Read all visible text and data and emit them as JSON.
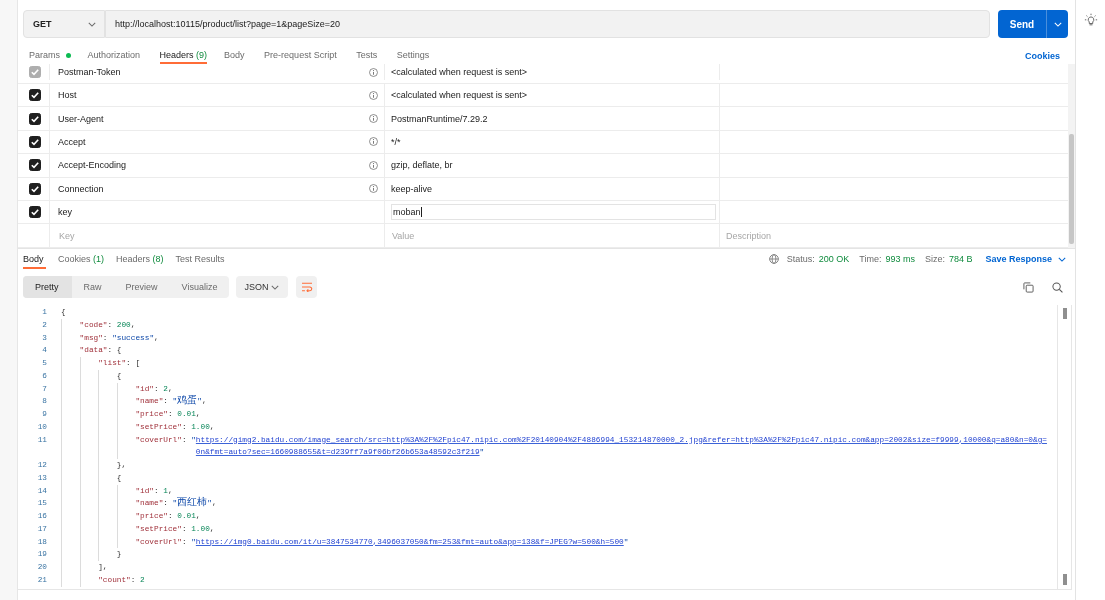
{
  "request": {
    "method": "GET",
    "url": "http://localhost:10115/product/list?page=1&pageSize=20",
    "send_label": "Send"
  },
  "request_tabs": [
    {
      "label": "Params",
      "indicator": true,
      "selected": false
    },
    {
      "label": "Authorization",
      "indicator": false,
      "selected": false
    },
    {
      "label": "Headers",
      "count": "(9)",
      "indicator": false,
      "selected": true
    },
    {
      "label": "Body",
      "indicator": false,
      "selected": false
    },
    {
      "label": "Pre-request Script",
      "indicator": false,
      "selected": false
    },
    {
      "label": "Tests",
      "indicator": false,
      "selected": false
    },
    {
      "label": "Settings",
      "indicator": false,
      "selected": false
    }
  ],
  "cookies_link": "Cookies",
  "headers_table": {
    "rows": [
      {
        "key": "Postman-Token",
        "value": "<calculated when request is sent>",
        "checked": true,
        "disabled": true,
        "auto": true,
        "editing": false
      },
      {
        "key": "Host",
        "value": "<calculated when request is sent>",
        "checked": true,
        "disabled": false,
        "auto": true,
        "editing": false
      },
      {
        "key": "User-Agent",
        "value": "PostmanRuntime/7.29.2",
        "checked": true,
        "disabled": false,
        "auto": true,
        "editing": false
      },
      {
        "key": "Accept",
        "value": "*/*",
        "checked": true,
        "disabled": false,
        "auto": true,
        "editing": false
      },
      {
        "key": "Accept-Encoding",
        "value": "gzip, deflate, br",
        "checked": true,
        "disabled": false,
        "auto": true,
        "editing": false
      },
      {
        "key": "Connection",
        "value": "keep-alive",
        "checked": true,
        "disabled": false,
        "auto": true,
        "editing": false
      },
      {
        "key": "key",
        "value": "moban",
        "checked": true,
        "disabled": false,
        "auto": false,
        "editing": true
      }
    ],
    "new_row": {
      "key": {
        "placeholder": "Key"
      },
      "value": {
        "placeholder": "Value"
      },
      "description": {
        "placeholder": "Description"
      }
    }
  },
  "response_tabs": [
    {
      "label": "Body",
      "selected": true
    },
    {
      "label": "Cookies",
      "count": "(1)",
      "selected": false
    },
    {
      "label": "Headers",
      "count": "(8)",
      "selected": false
    },
    {
      "label": "Test Results",
      "selected": false
    }
  ],
  "response_meta": {
    "status_label": "Status:",
    "status": "200 OK",
    "time_label": "Time:",
    "time": "993 ms",
    "size_label": "Size:",
    "size": "784 B",
    "save_label": "Save Response"
  },
  "view_modes": [
    {
      "label": "Pretty",
      "selected": true
    },
    {
      "label": "Raw",
      "selected": false
    },
    {
      "label": "Preview",
      "selected": false
    },
    {
      "label": "Visualize",
      "selected": false
    }
  ],
  "format": "JSON",
  "word_wrap": true,
  "code_lines": [
    {
      "number": "1",
      "tokens": [
        {
          "kind": "punct",
          "text": "{"
        }
      ],
      "children": [
        {
          "number": "2",
          "tokens": [
            {
              "kind": "key",
              "text": "\"code\""
            },
            {
              "kind": "punct",
              "text": ": "
            },
            {
              "kind": "number",
              "text": "200"
            },
            {
              "kind": "punct",
              "text": ","
            }
          ]
        },
        {
          "number": "3",
          "tokens": [
            {
              "kind": "key",
              "text": "\"msg\""
            },
            {
              "kind": "punct",
              "text": ": "
            },
            {
              "kind": "string",
              "text": "\"success\""
            },
            {
              "kind": "punct",
              "text": ","
            }
          ]
        },
        {
          "number": "4",
          "tokens": [
            {
              "kind": "key",
              "text": "\"data\""
            },
            {
              "kind": "punct",
              "text": ": {"
            }
          ],
          "children": [
            {
              "number": "5",
              "tokens": [
                {
                  "kind": "key",
                  "text": "\"list\""
                },
                {
                  "kind": "punct",
                  "text": ": ["
                }
              ],
              "children": [
                {
                  "number": "6",
                  "tokens": [
                    {
                      "kind": "punct",
                      "text": "{"
                    }
                  ],
                  "children": [
                    {
                      "number": "7",
                      "tokens": [
                        {
                          "kind": "key",
                          "text": "\"id\""
                        },
                        {
                          "kind": "punct",
                          "text": ": "
                        },
                        {
                          "kind": "number",
                          "text": "2"
                        },
                        {
                          "kind": "punct",
                          "text": ","
                        }
                      ]
                    },
                    {
                      "number": "8",
                      "tokens": [
                        {
                          "kind": "key",
                          "text": "\"name\""
                        },
                        {
                          "kind": "punct",
                          "text": ": "
                        },
                        {
                          "kind": "string",
                          "text": "\"鸡蛋\""
                        },
                        {
                          "kind": "punct",
                          "text": ","
                        }
                      ]
                    },
                    {
                      "number": "9",
                      "tokens": [
                        {
                          "kind": "key",
                          "text": "\"price\""
                        },
                        {
                          "kind": "punct",
                          "text": ": "
                        },
                        {
                          "kind": "number",
                          "text": "0.01"
                        },
                        {
                          "kind": "punct",
                          "text": ","
                        }
                      ]
                    },
                    {
                      "number": "10",
                      "tokens": [
                        {
                          "kind": "key",
                          "text": "\"setPrice\""
                        },
                        {
                          "kind": "punct",
                          "text": ": "
                        },
                        {
                          "kind": "number",
                          "text": "1.00"
                        },
                        {
                          "kind": "punct",
                          "text": ","
                        }
                      ]
                    },
                    {
                      "number": "11",
                      "tokens": [
                        {
                          "kind": "key",
                          "text": "\"coverUrl\""
                        },
                        {
                          "kind": "punct",
                          "text": ": "
                        },
                        {
                          "kind": "string",
                          "text": "\""
                        },
                        {
                          "kind": "link",
                          "text": "https://gimg2.baidu.com/image_search/src=http%3A%2F%2Fpic47.nipic.com%2F20140904%2F4886994_153214870000_2.jpg&refer=http%3A%2F%2Fpic47.nipic.com&app=2002&size=f9999,10000&q=a80&n=0&g=0n&fmt=auto?sec=1660988655&t=d239ff7a9f06bf26b653a48592c3f219"
                        },
                        {
                          "kind": "string",
                          "text": "\""
                        }
                      ]
                    }
                  ]
                },
                {
                  "number": "12",
                  "tokens": [
                    {
                      "kind": "punct",
                      "text": "},"
                    }
                  ]
                },
                {
                  "number": "13",
                  "tokens": [
                    {
                      "kind": "punct",
                      "text": "{"
                    }
                  ],
                  "children": [
                    {
                      "number": "14",
                      "tokens": [
                        {
                          "kind": "key",
                          "text": "\"id\""
                        },
                        {
                          "kind": "punct",
                          "text": ": "
                        },
                        {
                          "kind": "number",
                          "text": "1"
                        },
                        {
                          "kind": "punct",
                          "text": ","
                        }
                      ]
                    },
                    {
                      "number": "15",
                      "tokens": [
                        {
                          "kind": "key",
                          "text": "\"name\""
                        },
                        {
                          "kind": "punct",
                          "text": ": "
                        },
                        {
                          "kind": "string",
                          "text": "\"西红柿\""
                        },
                        {
                          "kind": "punct",
                          "text": ","
                        }
                      ]
                    },
                    {
                      "number": "16",
                      "tokens": [
                        {
                          "kind": "key",
                          "text": "\"price\""
                        },
                        {
                          "kind": "punct",
                          "text": ": "
                        },
                        {
                          "kind": "number",
                          "text": "0.01"
                        },
                        {
                          "kind": "punct",
                          "text": ","
                        }
                      ]
                    },
                    {
                      "number": "17",
                      "tokens": [
                        {
                          "kind": "key",
                          "text": "\"setPrice\""
                        },
                        {
                          "kind": "punct",
                          "text": ": "
                        },
                        {
                          "kind": "number",
                          "text": "1.00"
                        },
                        {
                          "kind": "punct",
                          "text": ","
                        }
                      ]
                    },
                    {
                      "number": "18",
                      "tokens": [
                        {
                          "kind": "key",
                          "text": "\"coverUrl\""
                        },
                        {
                          "kind": "punct",
                          "text": ": "
                        },
                        {
                          "kind": "string",
                          "text": "\""
                        },
                        {
                          "kind": "link",
                          "text": "https://img0.baidu.com/it/u=3847534770,3496037050&fm=253&fmt=auto&app=138&f=JPEG?w=500&h=500"
                        },
                        {
                          "kind": "string",
                          "text": "\""
                        }
                      ]
                    }
                  ]
                },
                {
                  "number": "19",
                  "tokens": [
                    {
                      "kind": "punct",
                      "text": "}"
                    }
                  ]
                }
              ]
            },
            {
              "number": "20",
              "tokens": [
                {
                  "kind": "punct",
                  "text": "],"
                }
              ]
            },
            {
              "number": "21",
              "tokens": [
                {
                  "kind": "key",
                  "text": "\"count\""
                },
                {
                  "kind": "punct",
                  "text": ": "
                },
                {
                  "kind": "number",
                  "text": "2"
                }
              ]
            }
          ]
        }
      ]
    }
  ]
}
